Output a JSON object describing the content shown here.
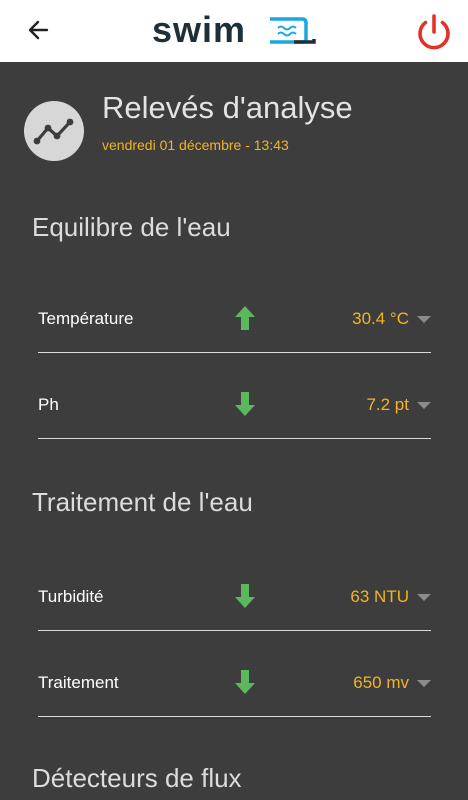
{
  "app": {
    "logo_text": "swim"
  },
  "icons": {
    "back": "arrow-left-icon",
    "power": "power-icon",
    "analysis": "trend-line-icon",
    "up": "arrow-up-icon",
    "down": "arrow-down-icon",
    "caret": "caret-down-icon"
  },
  "colors": {
    "accent_orange": "#f2b427",
    "power_red": "#e0322b",
    "arrow_green": "#5cb85c",
    "background_dark": "#3d3d3d",
    "logo_dark": "#1f2f3a",
    "logo_blue": "#1aa7e0"
  },
  "header": {
    "title": "Relevés d'analyse",
    "date": "vendredi 01 décembre - 13:43"
  },
  "sections": [
    {
      "title": "Equilibre de l'eau",
      "rows": [
        {
          "label": "Température",
          "trend": "up",
          "value": "30.4 °C"
        },
        {
          "label": "Ph",
          "trend": "down",
          "value": "7.2 pt"
        }
      ]
    },
    {
      "title": "Traitement de l'eau",
      "rows": [
        {
          "label": "Turbidité",
          "trend": "down",
          "value": "63 NTU"
        },
        {
          "label": "Traitement",
          "trend": "down",
          "value": "650 mv"
        }
      ]
    },
    {
      "title": "Détecteurs de flux",
      "rows": []
    }
  ]
}
